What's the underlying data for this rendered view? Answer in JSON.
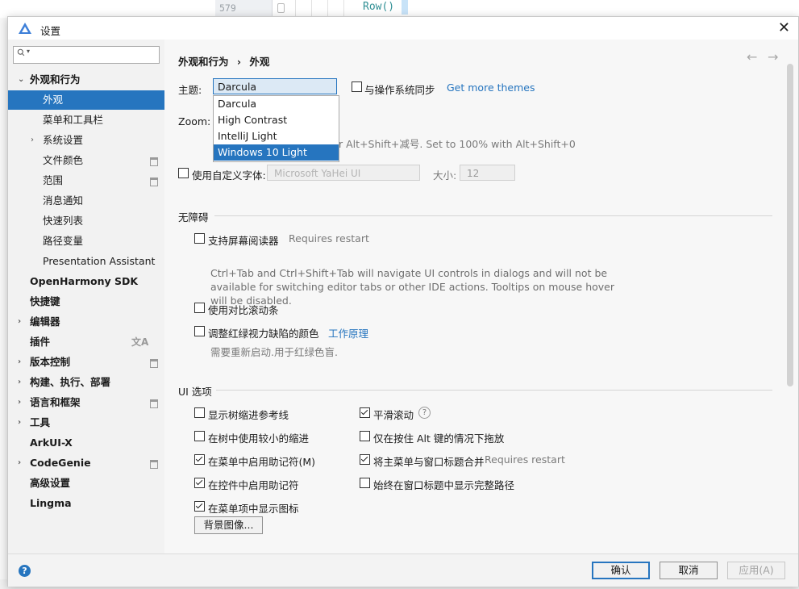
{
  "background": {
    "line_number": "579",
    "code": "Row()"
  },
  "dialog": {
    "title": "设置",
    "close_glyph": "✕"
  },
  "sidebar": {
    "search_placeholder": "",
    "items": [
      {
        "label": "外观和行为",
        "arrow": "⌄"
      },
      {
        "label": "外观"
      },
      {
        "label": "菜单和工具栏"
      },
      {
        "label": "系统设置",
        "arrow": "›"
      },
      {
        "label": "文件颜色"
      },
      {
        "label": "范围"
      },
      {
        "label": "消息通知"
      },
      {
        "label": "快速列表"
      },
      {
        "label": "路径变量"
      },
      {
        "label": "Presentation Assistant"
      },
      {
        "label": "OpenHarmony SDK"
      },
      {
        "label": "快捷键"
      },
      {
        "label": "编辑器",
        "arrow": "›"
      },
      {
        "label": "插件"
      },
      {
        "label": "版本控制",
        "arrow": "›"
      },
      {
        "label": "构建、执行、部署",
        "arrow": "›"
      },
      {
        "label": "语言和框架",
        "arrow": "›"
      },
      {
        "label": "工具",
        "arrow": "›"
      },
      {
        "label": "ArkUI-X"
      },
      {
        "label": "CodeGenie",
        "arrow": "›"
      },
      {
        "label": "高级设置"
      },
      {
        "label": "Lingma"
      }
    ]
  },
  "header": {
    "breadcrumb_parent": "外观和行为",
    "breadcrumb_sep": "›",
    "breadcrumb_current": "外观",
    "back_glyph": "←",
    "forward_glyph": "→"
  },
  "theme": {
    "label": "主题:",
    "selected": "Darcula",
    "options": [
      "Darcula",
      "High Contrast",
      "IntelliJ Light",
      "Windows 10 Light"
    ],
    "sync_label": "与操作系统同步",
    "get_more_link": "Get more themes"
  },
  "zoom": {
    "label": "Zoom:",
    "hint": "r Alt+Shift+减号. Set to 100% with Alt+Shift+0"
  },
  "font": {
    "custom_label": "使用自定义字体:",
    "font_value": "Microsoft YaHei UI",
    "size_label": "大小:",
    "size_value": "12"
  },
  "accessibility": {
    "title": "无障碍",
    "screen_reader_label": "支持屏幕阅读器",
    "screen_reader_note": "Requires restart",
    "screen_reader_desc_1": "Ctrl+Tab and Ctrl+Shift+Tab will navigate UI controls in dialogs and will not be",
    "screen_reader_desc_2": "available for switching editor tabs or other IDE actions. Tooltips on mouse hover",
    "screen_reader_desc_3": "will be disabled.",
    "contrast_scrollbar_label": "使用对比滚动条",
    "color_blind_label": "调整红绿视力缺陷的颜色",
    "how_it_works_link": "工作原理",
    "color_blind_note": "需要重新启动.用于红绿色盲."
  },
  "ui_options": {
    "title": "UI 选项",
    "left": [
      {
        "label": "显示树缩进参考线",
        "checked": false
      },
      {
        "label": "在树中使用较小的缩进",
        "checked": false
      },
      {
        "label": "在菜单中启用助记符(M)",
        "checked": true
      },
      {
        "label": "在控件中启用助记符",
        "checked": true
      },
      {
        "label": "在菜单项中显示图标",
        "checked": true
      }
    ],
    "right": [
      {
        "label": "平滑滚动",
        "checked": true,
        "help": "?"
      },
      {
        "label": "仅在按住 Alt 键的情况下拖放",
        "checked": false
      },
      {
        "label": "将主菜单与窗口标题合并",
        "checked": true,
        "note": "Requires restart"
      },
      {
        "label": "始终在窗口标题中显示完整路径",
        "checked": false
      }
    ],
    "background_image_button": "背景图像..."
  },
  "footer": {
    "help": "?",
    "ok": "确认",
    "cancel": "取消",
    "apply": "应用(A)"
  }
}
